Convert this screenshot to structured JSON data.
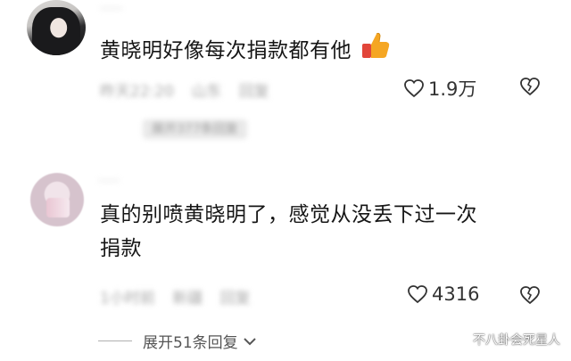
{
  "comments": [
    {
      "username": "·····",
      "text": "黄晓明好像每次捐款都有他",
      "meta": [
        "昨天22:20",
        "山东",
        "回复"
      ],
      "reply_preview": "展开377条回复",
      "likes": "1.9万"
    },
    {
      "username": "·····",
      "text_line1": "真的别喷黄晓明了，感觉从没丢下过一次",
      "text_line2": "捐款",
      "meta": [
        "1小时前",
        "新疆",
        "回复"
      ],
      "likes": "4316"
    }
  ],
  "expand_replies": "展开51条回复",
  "watermark": "不八卦会死星人",
  "colors": {
    "accent_thumb": "#f5a623",
    "thumb_red": "#e2463a"
  }
}
